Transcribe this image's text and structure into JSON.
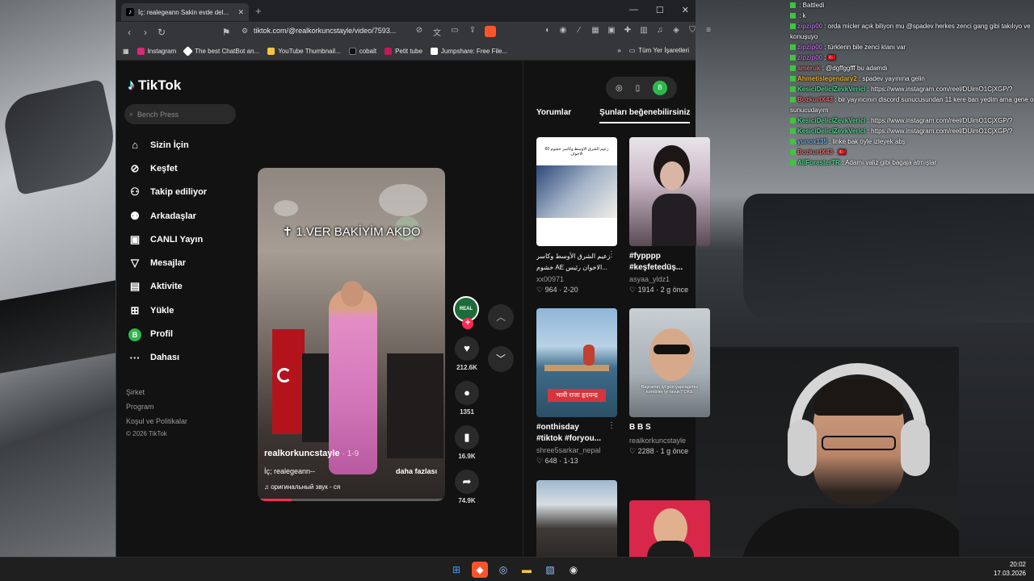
{
  "browser": {
    "tab_title": "İç: realegeann Sakin evde del...",
    "url": "tiktok.com/@realkorkuncstayle/video/7593...",
    "bookmarks": [
      "Instagram",
      "The best ChatBot an...",
      "YouTube Thumbnail...",
      "cobalt",
      "Petit tube",
      "Jumpshare: Free File..."
    ],
    "all_bookmarks": "Tüm Yer İşaretleri"
  },
  "tiktok": {
    "logo": "TikTok",
    "search_placeholder": "Bench Press",
    "menu": [
      {
        "label": "Sizin İçin",
        "icon": "home-icon"
      },
      {
        "label": "Keşfet",
        "icon": "compass-icon"
      },
      {
        "label": "Takip ediliyor",
        "icon": "user-follow-icon"
      },
      {
        "label": "Arkadaşlar",
        "icon": "friends-icon"
      },
      {
        "label": "CANLI Yayın",
        "icon": "live-icon"
      },
      {
        "label": "Mesajlar",
        "icon": "message-icon"
      },
      {
        "label": "Aktivite",
        "icon": "activity-icon"
      },
      {
        "label": "Yükle",
        "icon": "upload-icon"
      },
      {
        "label": "Profil",
        "icon": "avatar-b"
      },
      {
        "label": "Dahası",
        "icon": "more-icon"
      }
    ],
    "footer": {
      "company": "Şirket",
      "program": "Program",
      "terms": "Koşul ve Politikalar",
      "copyright": "© 2026 TikTok"
    },
    "avatar_letter": "B",
    "video": {
      "overlay_text": "1.VER BAKİYİM AKDO",
      "user": "realkorkuncstayle",
      "date": "· 1-9",
      "desc": "İç; realegeann--",
      "more": "daha fazlası",
      "sound": "оригинальный звук - ся",
      "progress": 0.18
    },
    "actions": {
      "likes": "212.6K",
      "comments": "1351",
      "saves": "16.9K",
      "shares": "74.9K",
      "avatar_text": "REAL"
    },
    "right_tabs": [
      "Yorumlar",
      "Şunları beğenebilirsiniz"
    ],
    "cards": [
      {
        "caption1": "زعيم الشرق الأوسط وكاسر",
        "caption2": "خشوم AE الاخوان رئيس...",
        "user": "xx00971",
        "likes": "964",
        "date": "2-20",
        "thumb_text": "زعيم الشرق الاوسط وكاسر خشوم 60 الاخوان"
      },
      {
        "caption1": "#fypppp",
        "caption2": "#keşfetedüş...",
        "user": "asyaa_yldz1",
        "likes": "1914",
        "date": "2 g önce"
      },
      {
        "caption1": "#onthisday",
        "caption2": "#tiktok #foryou...",
        "user": "shree5sarkar_nepal",
        "likes": "648",
        "date": "1-13",
        "thumb_text": "भावी राजा हृदयन्द्र"
      },
      {
        "caption1": "B B S",
        "caption2": "",
        "user": "realkorkuncstayle",
        "likes": "2288",
        "date": "1 g önce",
        "thumb_text": "Bayramın iyi gün yapcagımız kombiler iyi lavuk? OKE"
      }
    ]
  },
  "chat": [
    {
      "user": "",
      "text": "Battledi"
    },
    {
      "user": "",
      "text": "k"
    },
    {
      "user": "zipzip00",
      "text": "orda micler açık biliyon mu @spadev herkes zenci gang gibi takılıyo ve konuşuyo"
    },
    {
      "user": "zipzip00",
      "text": "türklerin bile zenci klanı var"
    },
    {
      "user": "zipzip00",
      "text": "🇹🇷"
    },
    {
      "user": "ameruk",
      "text": "@dgffggfff bu adamdı"
    },
    {
      "user": "Ahmetislegendary2",
      "text": "spadev yayınına gelin"
    },
    {
      "user": "KesiciDeliciZevkVerici",
      "text": "https://www.instagram.com/reel/DUimO1CjXGP/?"
    },
    {
      "user": "BozkurtX43",
      "text": "bir yayıncının discord sunucusundan 11 kere ban yedim ama gene o sunucudayım"
    },
    {
      "user": "KesiciDeliciZevkVerici",
      "text": "https://www.instagram.com/reel/DUimO1CjXGP/?"
    },
    {
      "user": "KesiciDeliciZevkVerici",
      "text": "https://www.instagram.com/reel/DUimO1CjXGP/?"
    },
    {
      "user": "yunox135",
      "text": "linke bak öyle izleyek abş"
    },
    {
      "user": "BozkurtX43",
      "text": "🇹🇷"
    },
    {
      "user": "AliForesterTR",
      "text": "Adamı valiz gibi bagaja atmışlar"
    }
  ],
  "taskbar": {
    "time": "20:02",
    "date": "17.03.2026"
  },
  "colors": {
    "accent": "#fe2c55",
    "chat_badge": "#3ec43e"
  }
}
